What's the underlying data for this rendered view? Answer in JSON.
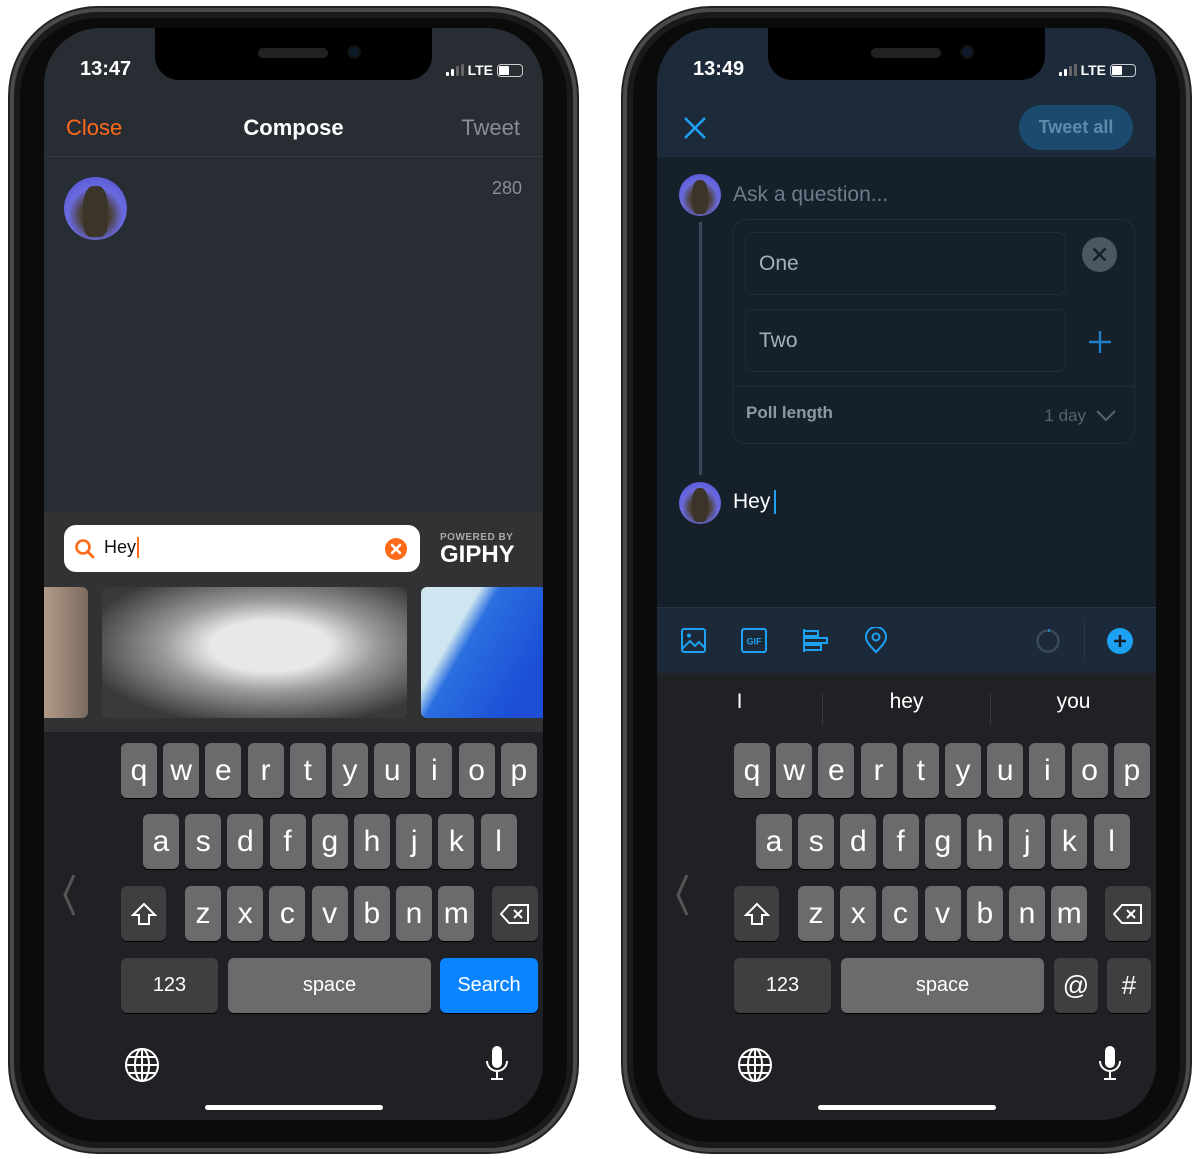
{
  "left_phone": {
    "status": {
      "time": "13:47",
      "network": "LTE"
    },
    "nav": {
      "close": "Close",
      "title": "Compose",
      "tweet": "Tweet"
    },
    "char_count": "280",
    "gif_search": {
      "value": "Hey",
      "powered_by": "POWERED BY",
      "brand": "GIPHY"
    },
    "gif_results": [
      "gif-person",
      "gif-cat",
      "gif-stitch"
    ],
    "keyboard": {
      "row1": [
        "q",
        "w",
        "e",
        "r",
        "t",
        "y",
        "u",
        "i",
        "o",
        "p"
      ],
      "row2": [
        "a",
        "s",
        "d",
        "f",
        "g",
        "h",
        "j",
        "k",
        "l"
      ],
      "row3": [
        "z",
        "x",
        "c",
        "v",
        "b",
        "n",
        "m"
      ],
      "numbers": "123",
      "space": "space",
      "action": "Search"
    },
    "colors": {
      "accent": "#ff6a1a",
      "background": "#282c33",
      "search_key": "#0a84ff"
    }
  },
  "right_phone": {
    "status": {
      "time": "13:49",
      "network": "LTE"
    },
    "header": {
      "tweet_all": "Tweet all"
    },
    "poll": {
      "question_placeholder": "Ask a question...",
      "options": [
        "One",
        "Two"
      ],
      "length_label": "Poll length",
      "length_value": "1 day"
    },
    "tweet_text": "Hey",
    "toolbar": [
      "image-icon",
      "gif-icon",
      "poll-icon",
      "location-icon",
      "progress-ring-icon",
      "add-icon"
    ],
    "suggestions": [
      "I",
      "hey",
      "you"
    ],
    "keyboard": {
      "row1": [
        "q",
        "w",
        "e",
        "r",
        "t",
        "y",
        "u",
        "i",
        "o",
        "p"
      ],
      "row2": [
        "a",
        "s",
        "d",
        "f",
        "g",
        "h",
        "j",
        "k",
        "l"
      ],
      "row3": [
        "z",
        "x",
        "c",
        "v",
        "b",
        "n",
        "m"
      ],
      "numbers": "123",
      "space": "space",
      "at": "@",
      "hash": "#"
    },
    "colors": {
      "accent": "#1da1f2",
      "background": "#15202b",
      "header": "#1c2a3a"
    }
  }
}
